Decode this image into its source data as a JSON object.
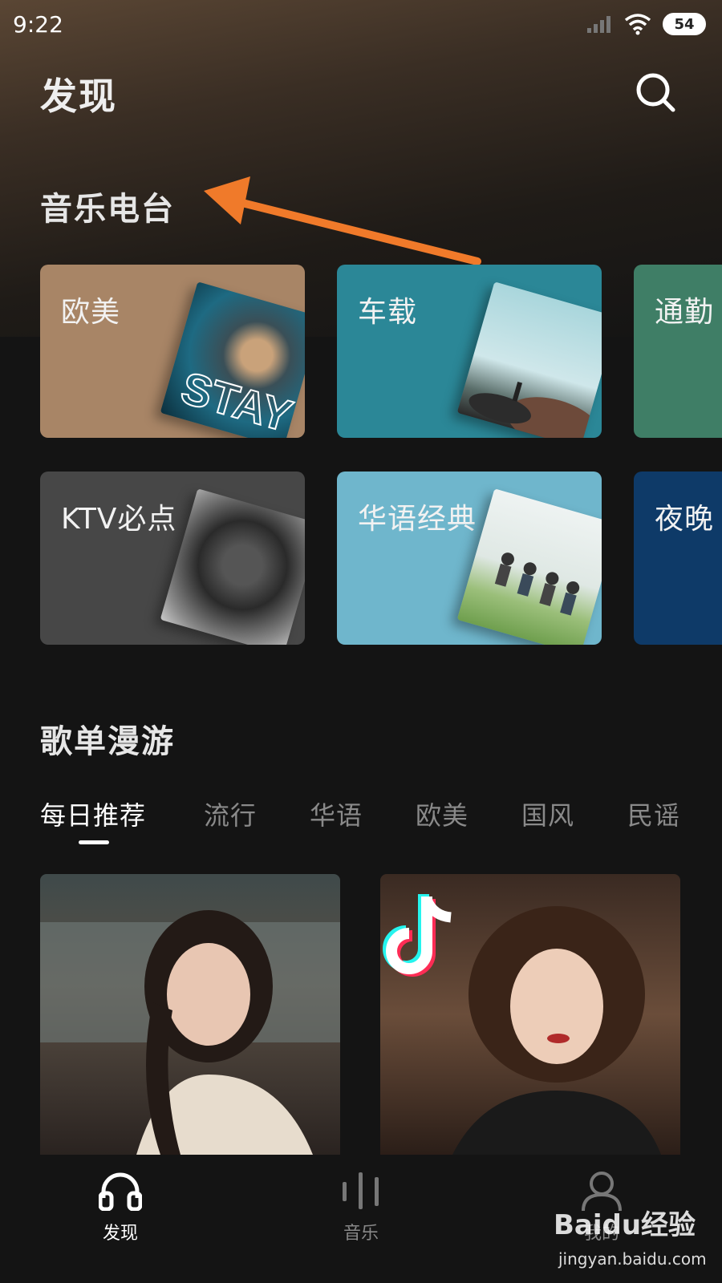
{
  "status_bar": {
    "time": "9:22",
    "battery": "54",
    "icons": [
      "signal-icon",
      "wifi-icon",
      "battery-icon"
    ]
  },
  "header": {
    "title": "发现",
    "search_icon": "search-icon"
  },
  "radio_section": {
    "title": "音乐电台",
    "cards": [
      {
        "label": "欧美",
        "color": "#a88566"
      },
      {
        "label": "车载",
        "color": "#2b8797"
      },
      {
        "label": "通勤",
        "color": "#3f7e66"
      },
      {
        "label": "KTV必点",
        "color": "#474747"
      },
      {
        "label": "华语经典",
        "color": "#6fb6cc"
      },
      {
        "label": "夜晚",
        "color": "#0e3a68"
      }
    ]
  },
  "playlist_section": {
    "title": "歌单漫游",
    "tabs": [
      "每日推荐",
      "流行",
      "华语",
      "欧美",
      "国风",
      "民谣"
    ],
    "active_tab": "每日推荐"
  },
  "bottom_nav": {
    "items": [
      {
        "label": "发现",
        "icon": "headphones-icon",
        "active": true
      },
      {
        "label": "音乐",
        "icon": "bars-icon",
        "active": false
      },
      {
        "label": "我的",
        "icon": "person-icon",
        "active": false
      }
    ]
  },
  "watermark": {
    "logo": "Baidu经验",
    "url": "jingyan.baidu.com"
  },
  "colors": {
    "accent_arrow": "#f07a2a",
    "background": "#141414"
  }
}
